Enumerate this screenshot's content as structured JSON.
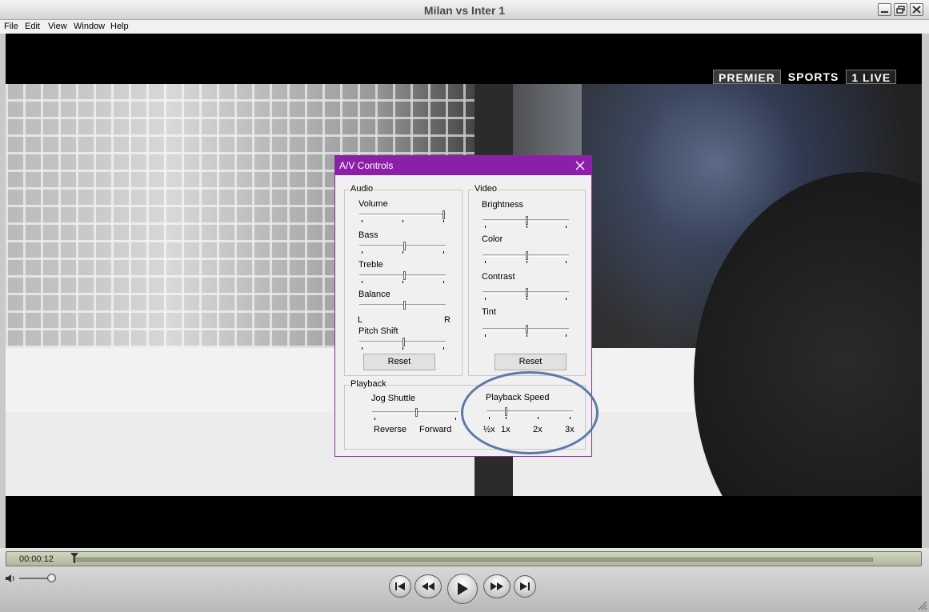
{
  "window": {
    "title": "Milan vs Inter 1"
  },
  "menu": [
    "File",
    "Edit",
    "View",
    "Window",
    "Help"
  ],
  "video": {
    "logo": [
      "PREMIER",
      "SPORTS",
      "1 LIVE"
    ]
  },
  "player": {
    "timecode": "00:00:12",
    "progress": 0.0
  },
  "av_controls": {
    "title": "A/V Controls",
    "audio": {
      "label": "Audio",
      "volume": "Volume",
      "bass": "Bass",
      "treble": "Treble",
      "balance": "Balance",
      "balance_left": "L",
      "balance_right": "R",
      "pitch_shift": "Pitch Shift",
      "reset": "Reset"
    },
    "video": {
      "label": "Video",
      "brightness": "Brightness",
      "color": "Color",
      "contrast": "Contrast",
      "tint": "Tint",
      "reset": "Reset"
    },
    "playback": {
      "label": "Playback",
      "jog_shuttle": "Jog Shuttle",
      "reverse": "Reverse",
      "forward": "Forward",
      "playback_speed": "Playback Speed",
      "speed_ticks": [
        "½x",
        "1x",
        "2x",
        "3x"
      ]
    }
  },
  "colors": {
    "dialog_title": "#8b1fa8",
    "highlight": "#5b7aa6"
  },
  "icons": [
    "minimize-icon",
    "restore-icon",
    "close-icon",
    "volume-icon",
    "skip-back-icon",
    "rewind-icon",
    "play-icon",
    "fast-forward-icon",
    "skip-forward-icon"
  ]
}
